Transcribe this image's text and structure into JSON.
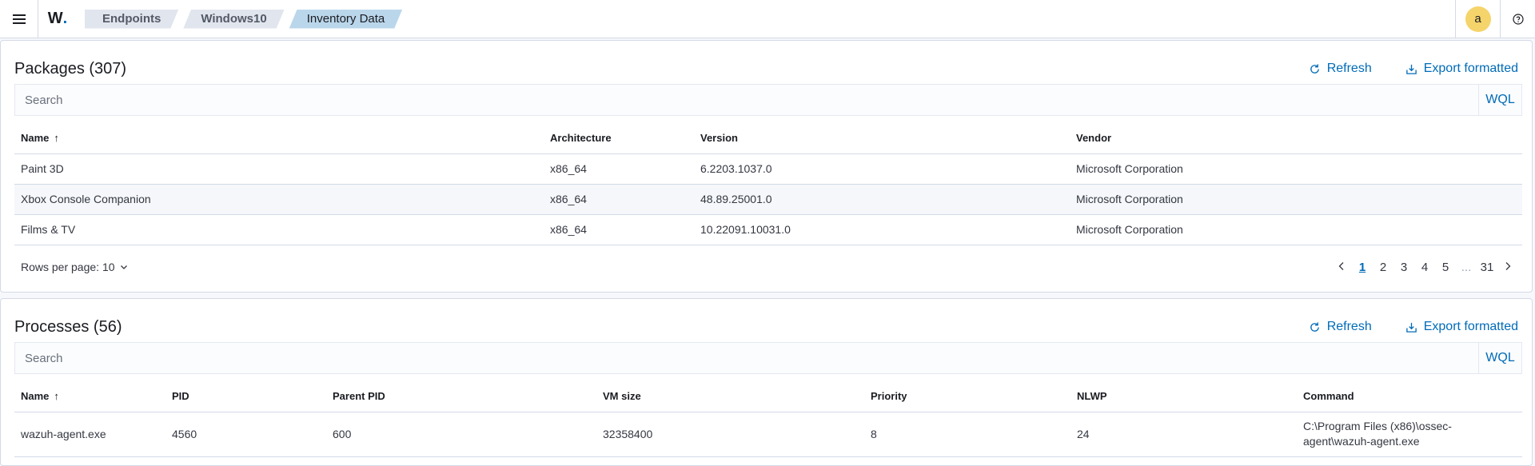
{
  "header": {
    "brand": "W",
    "brand_dot": ".",
    "breadcrumbs": [
      "Endpoints",
      "Windows10",
      "Inventory Data"
    ],
    "avatar_letter": "a"
  },
  "packages": {
    "title": "Packages (307)",
    "refresh_label": "Refresh",
    "export_label": "Export formatted",
    "search_placeholder": "Search",
    "wql_label": "WQL",
    "columns": [
      "Name",
      "Architecture",
      "Version",
      "Vendor"
    ],
    "rows": [
      [
        "Paint 3D",
        "x86_64",
        "6.2203.1037.0",
        "Microsoft Corporation"
      ],
      [
        "Xbox Console Companion",
        "x86_64",
        "48.89.25001.0",
        "Microsoft Corporation"
      ],
      [
        "Films & TV",
        "x86_64",
        "10.22091.10031.0",
        "Microsoft Corporation"
      ]
    ],
    "rows_per_page": "Rows per page: 10",
    "pagination": {
      "pages": [
        "1",
        "2",
        "3",
        "4",
        "5"
      ],
      "ellipsis": "...",
      "last": "31",
      "current": "1"
    }
  },
  "processes": {
    "title": "Processes (56)",
    "refresh_label": "Refresh",
    "export_label": "Export formatted",
    "search_placeholder": "Search",
    "wql_label": "WQL",
    "columns": [
      "Name",
      "PID",
      "Parent PID",
      "VM size",
      "Priority",
      "NLWP",
      "Command"
    ],
    "rows": [
      [
        "wazuh-agent.exe",
        "4560",
        "600",
        "32358400",
        "8",
        "24",
        "C:\\Program Files (x86)\\ossec-agent\\wazuh-agent.exe"
      ]
    ]
  }
}
